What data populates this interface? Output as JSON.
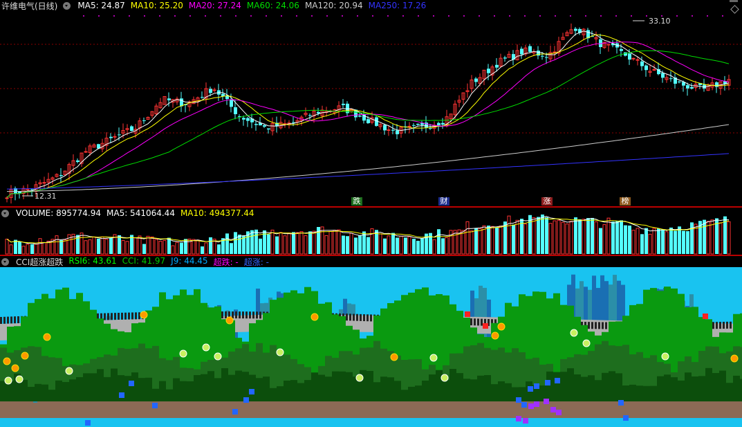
{
  "main_panel": {
    "title": "许维电气(日线)",
    "ma_labels": [
      {
        "text": "MA5: 24.87",
        "color": "#ffffff"
      },
      {
        "text": "MA10: 25.20",
        "color": "#ffff00"
      },
      {
        "text": "MA20: 27.24",
        "color": "#ff00ff"
      },
      {
        "text": "MA60: 24.06",
        "color": "#00dd00"
      },
      {
        "text": "MA120: 20.94",
        "color": "#cccccc"
      },
      {
        "text": "MA250: 17.26",
        "color": "#3333ff"
      }
    ],
    "high_label": "33.10",
    "low_label": "12.31",
    "signals": [
      {
        "text": "跌",
        "bg": "#1e6e1e",
        "fg": "#ffffff"
      },
      {
        "text": "财",
        "bg": "#1e2e8e",
        "fg": "#ffffff"
      },
      {
        "text": "涨",
        "bg": "#8e1e1e",
        "fg": "#ffffff"
      },
      {
        "text": "榜",
        "bg": "#8e5a1e",
        "fg": "#ffffff"
      }
    ]
  },
  "volume_panel": {
    "labels": [
      {
        "text": "VOLUME: 895774.94",
        "color": "#ffffff"
      },
      {
        "text": "MA5: 541064.44",
        "color": "#ffffff"
      },
      {
        "text": "MA10: 494377.44",
        "color": "#ffff00"
      }
    ]
  },
  "indicator_panel": {
    "title": "CCI超涨超跌",
    "labels": [
      {
        "text": "RSI6: 43.61",
        "color": "#00ff00"
      },
      {
        "text": "CCI: 41.97",
        "color": "#00cc00"
      },
      {
        "text": "J9: 44.45",
        "color": "#00aaff"
      },
      {
        "text": "超跌: -",
        "color": "#ff00ff"
      },
      {
        "text": "超涨: -",
        "color": "#3366ff"
      }
    ]
  },
  "colors": {
    "up": "#ff3333",
    "down": "#54ffff",
    "sky": "#19c3f0",
    "ground": "#8b6a55"
  },
  "chart_data": {
    "type": "candlestick",
    "price_range": [
      12.31,
      33.1
    ],
    "close_path_keypoints": [
      12.3,
      13.0,
      14.5,
      17.5,
      19.0,
      20.5,
      24.0,
      23.5,
      25.5,
      22.0,
      20.5,
      21.0,
      22.5,
      23.0,
      21.5,
      20.0,
      20.5,
      21.5,
      26.0,
      28.5,
      30.0,
      29.5,
      33.1,
      31.0,
      29.5,
      27.5,
      26.0,
      25.2,
      26.5
    ]
  }
}
